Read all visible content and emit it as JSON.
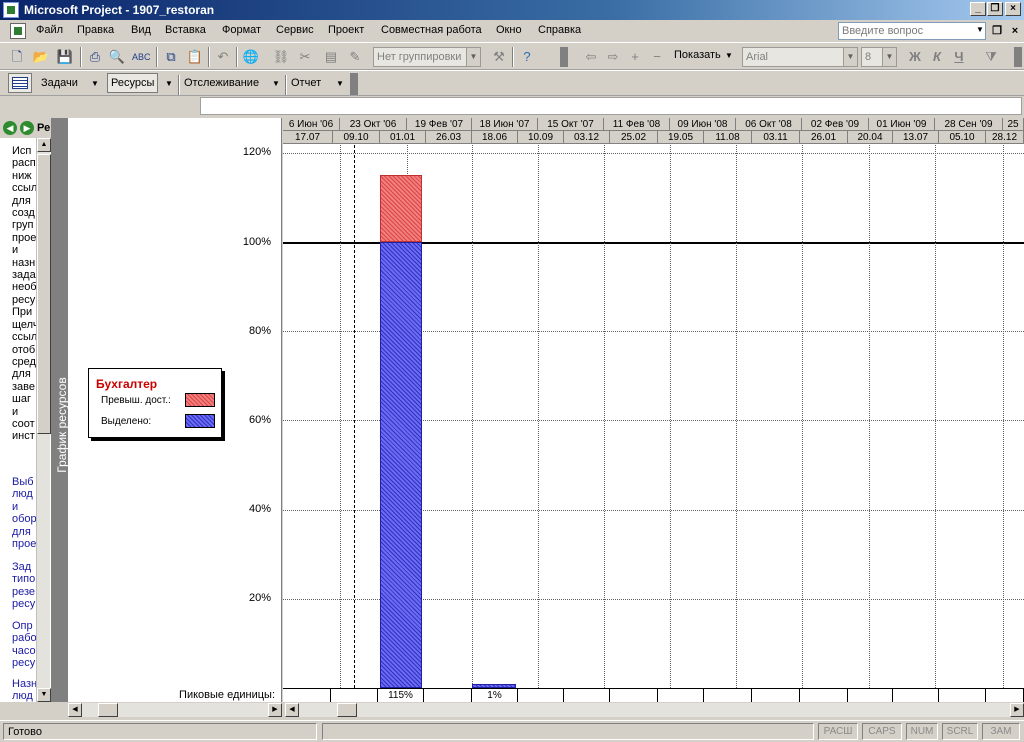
{
  "window": {
    "title": "Microsoft Project - 1907_restoran"
  },
  "menu": [
    "Файл",
    "Правка",
    "Вид",
    "Вставка",
    "Формат",
    "Сервис",
    "Проект",
    "Совместная работа",
    "Окно",
    "Справка"
  ],
  "help": {
    "placeholder": "Введите вопрос"
  },
  "toolbar1": {
    "grouping": "Нет группировки",
    "show_label": "Показать",
    "font": "Arial",
    "font_size": "8",
    "bold": "Ж",
    "italic": "К",
    "underline": "Ч"
  },
  "toolbar2": {
    "tasks": "Задачи",
    "resources": "Ресурсы",
    "tracking": "Отслеживание",
    "report": "Отчет"
  },
  "sidepane": {
    "title": "Ре",
    "text_black": "Исп\nрасп\nниж\nссыл\nдля\nсозд\nгруп\nпрое\nи\nназн\nзада\nнеоб\nресу\nПри\nщелч\nссыл\nотоб\nсред\nдля\nзаве\nшаг\nи\nсоот\nинст",
    "link1": "Выб\nлюд\nи\nобор\nдля\nпрое",
    "link2": "Зад\nтипо\nрезе\nресу",
    "link3": "Опр\nрабо\nчасо\nресу",
    "link4": "Назн\nлюд"
  },
  "view_bar": {
    "label": "График ресурсов"
  },
  "legend": {
    "resource": "Бухгалтер",
    "overallocated": "Превыш. дост.:",
    "allocated": "Выделено:"
  },
  "y_axis": [
    "120%",
    "100%",
    "80%",
    "60%",
    "40%",
    "20%"
  ],
  "peak": {
    "label": "Пиковые единицы:",
    "values": [
      "",
      "",
      "115%",
      "",
      "1%",
      "",
      "",
      "",
      "",
      "",
      "",
      "",
      "",
      "",
      "",
      ""
    ]
  },
  "timescale": {
    "top": [
      "6 Июн '06",
      "23 Окт '06",
      "19 Фев '07",
      "18 Июн '07",
      "15 Окт '07",
      "11 Фев '08",
      "09 Июн '08",
      "06 Окт '08",
      "02 Фев '09",
      "01 Июн '09",
      "28 Сен '09",
      "25"
    ],
    "bottom": [
      "17.07",
      "09.10",
      "01.01",
      "26.03",
      "18.06",
      "10.09",
      "03.12",
      "25.02",
      "19.05",
      "11.08",
      "03.11",
      "26.01",
      "20.04",
      "13.07",
      "05.10",
      "28.12"
    ]
  },
  "chart_data": {
    "type": "bar",
    "series": [
      {
        "name": "Выделено:",
        "color": "#6b6bf0",
        "values": [
          100,
          1
        ]
      },
      {
        "name": "Превыш. дост.:",
        "color": "#f08080",
        "values": [
          15,
          0
        ]
      }
    ],
    "peak_units": [
      115,
      1
    ],
    "ylim": [
      0,
      125
    ]
  },
  "status": {
    "ready": "Готово",
    "indicators": [
      "РАСШ",
      "CAPS",
      "NUM",
      "SCRL",
      "ЗАМ"
    ]
  }
}
